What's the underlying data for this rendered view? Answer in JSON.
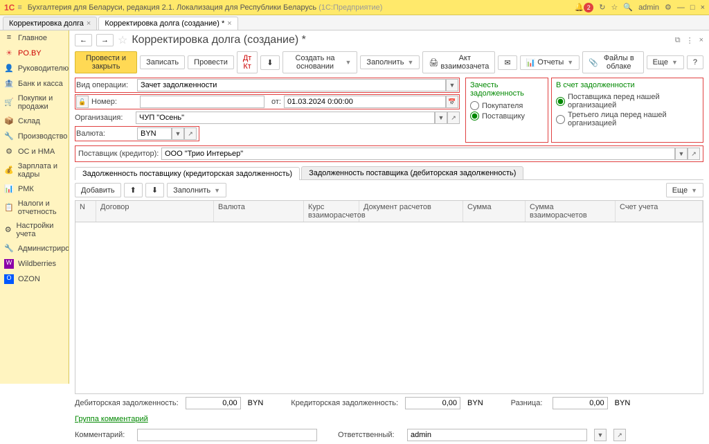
{
  "app": {
    "title": "Бухгалтерия для Беларуси, редакция 2.1. Локализация для Республики Беларусь",
    "suffix": "(1С:Предприятие)",
    "user": "admin",
    "notif_count": "2"
  },
  "tabs": [
    {
      "label": "Корректировка долга"
    },
    {
      "label": "Корректировка долга (создание) *"
    }
  ],
  "sidebar": [
    {
      "icon": "≡",
      "label": "Главное"
    },
    {
      "icon": "☀",
      "label": "PO.BY"
    },
    {
      "icon": "👤",
      "label": "Руководителю"
    },
    {
      "icon": "🏦",
      "label": "Банк и касса"
    },
    {
      "icon": "🛒",
      "label": "Покупки и продажи"
    },
    {
      "icon": "📦",
      "label": "Склад"
    },
    {
      "icon": "🔧",
      "label": "Производство"
    },
    {
      "icon": "⚙",
      "label": "ОС и НМА"
    },
    {
      "icon": "💰",
      "label": "Зарплата и кадры"
    },
    {
      "icon": "📊",
      "label": "РМК"
    },
    {
      "icon": "📋",
      "label": "Налоги и отчетность"
    },
    {
      "icon": "⚙",
      "label": "Настройки учета"
    },
    {
      "icon": "🔧",
      "label": "Администрирование"
    },
    {
      "icon": "W",
      "label": "Wildberries"
    },
    {
      "icon": "O",
      "label": "OZON"
    }
  ],
  "page": {
    "title": "Корректировка долга (создание) *"
  },
  "toolbar": {
    "post_close": "Провести и закрыть",
    "save": "Записать",
    "post": "Провести",
    "create_based": "Создать на основании",
    "fill": "Заполнить",
    "act": "Акт взаимозачета",
    "reports": "Отчеты",
    "cloud_files": "Файлы в облаке",
    "more": "Еще"
  },
  "form": {
    "op_type_label": "Вид операции:",
    "op_type_value": "Зачет задолженности",
    "number_label": "Номер:",
    "number_value": "",
    "date_label": "от:",
    "date_value": "01.03.2024 0:00:00",
    "org_label": "Организация:",
    "org_value": "ЧУП \"Осень\"",
    "currency_label": "Валюта:",
    "currency_value": "BYN"
  },
  "group1": {
    "title": "Зачесть задолженность",
    "opt1": "Покупателя",
    "opt2": "Поставщику"
  },
  "group2": {
    "title": "В счет задолженности",
    "opt1": "Поставщика перед нашей организацией",
    "opt2": "Третьего лица перед нашей организацией"
  },
  "creditor": {
    "label": "Поставщик (кредитор):",
    "value": "ООО \"Трио Интерьер\""
  },
  "subtabs": [
    "Задолженность поставщику (кредиторская задолженность)",
    "Задолженность поставщика (дебиторская задолженность)"
  ],
  "sub_toolbar": {
    "add": "Добавить",
    "fill": "Заполнить",
    "more": "Еще"
  },
  "columns": {
    "n": "N",
    "contract": "Договор",
    "currency": "Валюта",
    "rate": "Курс взаиморасчетов",
    "doc": "Документ расчетов",
    "sum": "Сумма",
    "sum_rate": "Сумма взаиморасчетов",
    "account": "Счет учета"
  },
  "footer": {
    "debit_label": "Дебиторская задолженность:",
    "debit_value": "0,00",
    "debit_cur": "BYN",
    "credit_label": "Кредиторская задолженность:",
    "credit_value": "0,00",
    "credit_cur": "BYN",
    "diff_label": "Разница:",
    "diff_value": "0,00",
    "diff_cur": "BYN",
    "comment_group": "Группа комментарий",
    "comment_label": "Комментарий:",
    "responsible_label": "Ответственный:",
    "responsible_value": "admin"
  }
}
